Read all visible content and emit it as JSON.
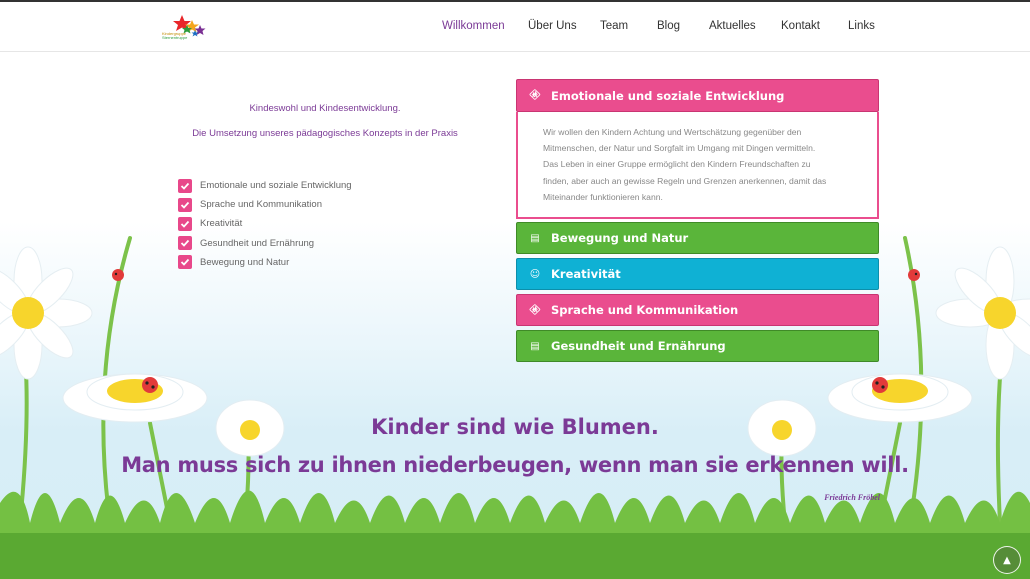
{
  "logo": {
    "text_line1": "Kindergruppe",
    "text_line2": "Sternentruppe"
  },
  "nav": {
    "items": [
      {
        "label": "Willkommen",
        "active": true
      },
      {
        "label": "Über Uns",
        "active": false
      },
      {
        "label": "Team",
        "active": false
      },
      {
        "label": "Blog",
        "active": false
      },
      {
        "label": "Aktuelles",
        "active": false
      },
      {
        "label": "Kontakt",
        "active": false
      },
      {
        "label": "Links",
        "active": false
      }
    ]
  },
  "intro": {
    "line1": "Kindeswohl und Kindesentwicklung.",
    "line2": "Die Umsetzung unseres pädagogisches Konzepts in der Praxis"
  },
  "checklist": [
    "Emotionale und soziale Entwicklung",
    "Sprache und Kommunikation",
    "Kreativität",
    "Gesundheit und Ernährung",
    "Bewegung und Natur"
  ],
  "accordion": {
    "panels": [
      {
        "title": "Emotionale und soziale Entwicklung",
        "icon": "child-icon",
        "color": "#ea4d8e",
        "open": true
      },
      {
        "title": "Bewegung und Natur",
        "icon": "book-icon",
        "color": "#5ab53a",
        "open": false
      },
      {
        "title": "Kreativität",
        "icon": "smile-icon",
        "color": "#0fb1d4",
        "open": false
      },
      {
        "title": "Sprache und Kommunikation",
        "icon": "child-icon",
        "color": "#ea4d8e",
        "open": false
      },
      {
        "title": "Gesundheit und Ernährung",
        "icon": "book-icon",
        "color": "#5ab53a",
        "open": false
      }
    ],
    "open_body": [
      "Wir wollen den Kindern Achtung und Wertschätzung gegenüber den",
      "Mitmenschen, der Natur und Sorgfalt im Umgang mit Dingen vermitteln.",
      "Das Leben in einer Gruppe ermöglicht den Kindern Freundschaften zu",
      "finden, aber auch an gewisse Regeln und Grenzen anerkennen, damit das",
      "Miteinander funktionieren kann."
    ]
  },
  "quote": {
    "line1": "Kinder sind wie Blumen.",
    "line2": "Man muss sich zu ihnen niederbeugen, wenn man sie erkennen will.",
    "author": "Friedrich Fröbel"
  },
  "colors": {
    "brand_purple": "#7b3a96",
    "pink": "#ea4d8e",
    "green": "#5ab53a",
    "blue": "#0fb1d4"
  }
}
